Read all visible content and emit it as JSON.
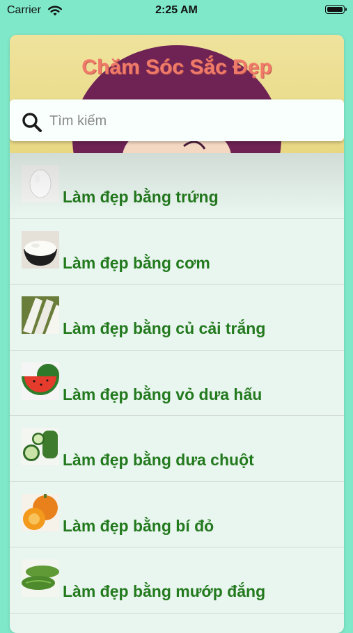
{
  "status_bar": {
    "carrier": "Carrier",
    "time": "2:25 AM",
    "wifi_icon": "wifi-icon",
    "battery_icon": "battery-icon"
  },
  "header": {
    "title": "Chăm Sóc Sắc Đẹp"
  },
  "search": {
    "placeholder": "Tìm kiếm",
    "value": "",
    "icon": "search-icon"
  },
  "list": {
    "items": [
      {
        "label": "Làm đẹp bằng trứng",
        "thumbnail": "egg-thumbnail"
      },
      {
        "label": "Làm đẹp bằng cơm",
        "thumbnail": "rice-bowl-thumbnail"
      },
      {
        "label": "Làm đẹp bằng củ cải trắng",
        "thumbnail": "white-radish-thumbnail"
      },
      {
        "label": "Làm đẹp bằng vỏ dưa hấu",
        "thumbnail": "watermelon-thumbnail"
      },
      {
        "label": "Làm đẹp bằng dưa chuột",
        "thumbnail": "cucumber-thumbnail"
      },
      {
        "label": "Làm đẹp bằng bí đỏ",
        "thumbnail": "pumpkin-thumbnail"
      },
      {
        "label": "Làm đẹp bằng mướp đắng",
        "thumbnail": "bitter-melon-thumbnail"
      }
    ]
  },
  "colors": {
    "background": "#7ee8c8",
    "title": "#f07a6a",
    "item_text": "#237a1e",
    "header_bg": "#efe39d"
  }
}
